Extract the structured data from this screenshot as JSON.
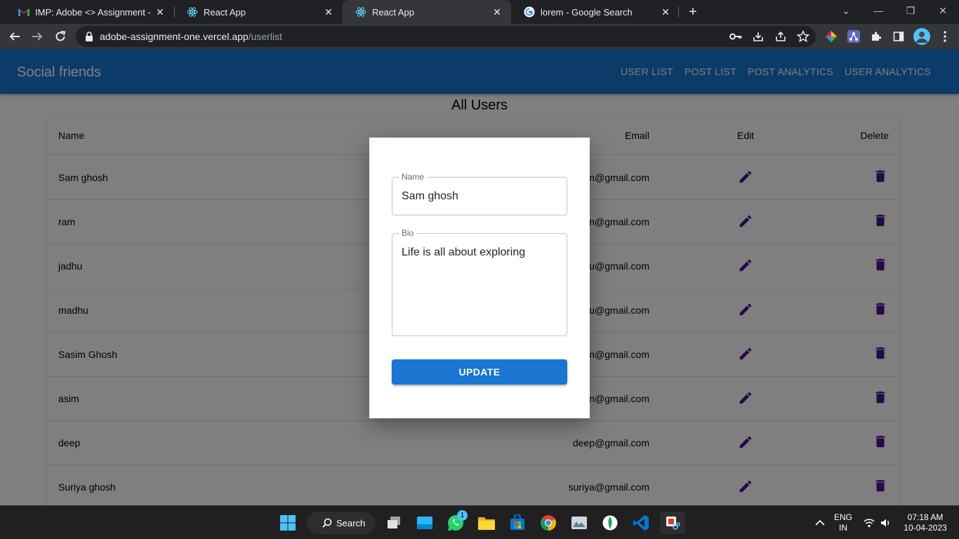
{
  "browser": {
    "tabs": [
      {
        "title": "IMP: Adobe <> Assignment - gh",
        "icon": "gmail-icon"
      },
      {
        "title": "React App",
        "icon": "react-icon"
      },
      {
        "title": "React App",
        "icon": "react-icon",
        "active": true
      },
      {
        "title": "lorem - Google Search",
        "icon": "google-icon"
      }
    ],
    "url_host": "adobe-assignment-one.vercel.app",
    "url_path": "/userlist"
  },
  "app": {
    "brand": "Social friends",
    "nav": [
      "USER LIST",
      "POST LIST",
      "POST ANALYTICS",
      "USER ANALYTICS"
    ]
  },
  "page": {
    "heading": "All Users",
    "columns": {
      "name": "Name",
      "email": "Email",
      "edit": "Edit",
      "delete": "Delete"
    },
    "rows": [
      {
        "name": "Sam ghosh",
        "email": "n@gmail.com"
      },
      {
        "name": "ram",
        "email": "n@gmail.com"
      },
      {
        "name": "jadhu",
        "email": "u@gmail.com"
      },
      {
        "name": "madhu",
        "email": "u@gmail.com"
      },
      {
        "name": "Sasim Ghosh",
        "email": "n@gmail.com"
      },
      {
        "name": "asim",
        "email": "n@gmail.com"
      },
      {
        "name": "deep",
        "email": "deep@gmail.com"
      },
      {
        "name": "Suriya ghosh",
        "email": "suriya@gmail.com"
      }
    ],
    "icon_color": "#4a148c"
  },
  "modal": {
    "name_label": "Name",
    "name_value": "Sam ghosh",
    "bio_label": "Bio",
    "bio_value": "Life is all about exploring",
    "update_label": "UPDATE"
  },
  "taskbar": {
    "search_label": "Search",
    "whatsapp_badge": "1",
    "lang_line1": "ENG",
    "lang_line2": "IN",
    "time": "07:18 AM",
    "date": "10-04-2023"
  }
}
